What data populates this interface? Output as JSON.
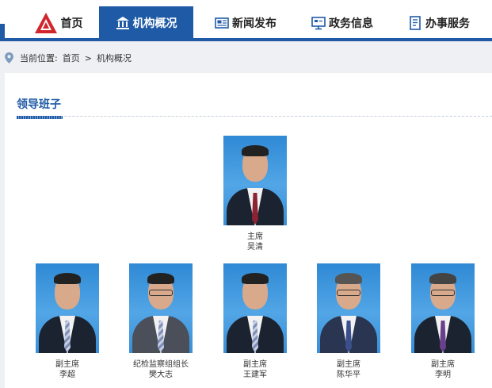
{
  "nav": {
    "items": [
      {
        "label": "首页",
        "icon": "logo-icon"
      },
      {
        "label": "机构概况",
        "icon": "building-icon",
        "active": true
      },
      {
        "label": "新闻发布",
        "icon": "newspaper-icon"
      },
      {
        "label": "政务信息",
        "icon": "monitor-icon"
      },
      {
        "label": "办事服务",
        "icon": "document-icon"
      }
    ],
    "accent_color": "#1e5aa6",
    "logo_color": "#d1262b"
  },
  "breadcrumb": {
    "prefix": "当前位置:",
    "home": "首页",
    "separator": ">",
    "current": "机构概况"
  },
  "section": {
    "title": "领导班子"
  },
  "leaders": [
    {
      "role": "主席",
      "name": "吴清"
    },
    {
      "role": "副主席",
      "name": "李超"
    },
    {
      "role": "纪检监察组组长",
      "name": "樊大志"
    },
    {
      "role": "副主席",
      "name": "王建军"
    },
    {
      "role": "副主席",
      "name": "陈华平"
    },
    {
      "role": "副主席",
      "name": "李明"
    }
  ]
}
